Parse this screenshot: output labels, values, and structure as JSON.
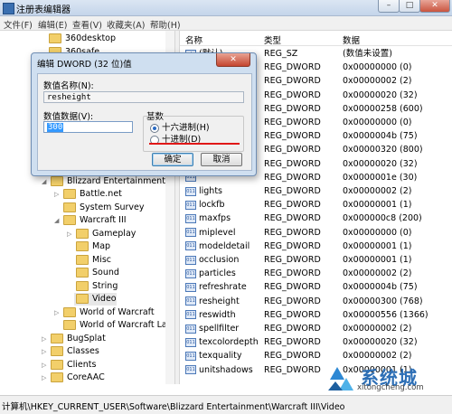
{
  "window": {
    "title": "注册表编辑器",
    "min": "–",
    "max": "□",
    "close": "✕"
  },
  "menu": [
    "文件(F)",
    "编辑(E)",
    "查看(V)",
    "收藏夹(A)",
    "帮助(H)"
  ],
  "tree": {
    "items": [
      {
        "label": "360desktop"
      },
      {
        "label": "360safe"
      },
      {
        "label": "Blizzard Entertainment"
      },
      {
        "label": "Battle.net"
      },
      {
        "label": "System Survey"
      },
      {
        "label": "Warcraft III"
      },
      {
        "label": "Gameplay"
      },
      {
        "label": "Map"
      },
      {
        "label": "Misc"
      },
      {
        "label": "Sound"
      },
      {
        "label": "String"
      },
      {
        "label": "Video"
      },
      {
        "label": "World of Warcraft"
      },
      {
        "label": "World of Warcraft Laur"
      },
      {
        "label": "BugSplat"
      },
      {
        "label": "Classes"
      },
      {
        "label": "Clients"
      },
      {
        "label": "CoreAAC"
      }
    ]
  },
  "list": {
    "headers": {
      "name": "名称",
      "type": "类型",
      "data": "数据"
    },
    "rows": [
      {
        "name": "(默认)",
        "type": "REG_SZ",
        "data": "(数值未设置)"
      },
      {
        "name": "",
        "type": "REG_DWORD",
        "data": "0x00000000 (0)"
      },
      {
        "name": "",
        "type": "REG_DWORD",
        "data": "0x00000002 (2)"
      },
      {
        "name": "",
        "type": "REG_DWORD",
        "data": "0x00000020 (32)"
      },
      {
        "name": "",
        "type": "REG_DWORD",
        "data": "0x00000258 (600)"
      },
      {
        "name": "",
        "type": "REG_DWORD",
        "data": "0x00000000 (0)"
      },
      {
        "name": "",
        "type": "REG_DWORD",
        "data": "0x0000004b (75)"
      },
      {
        "name": "",
        "type": "REG_DWORD",
        "data": "0x00000320 (800)"
      },
      {
        "name": "",
        "type": "REG_DWORD",
        "data": "0x00000020 (32)"
      },
      {
        "name": "",
        "type": "REG_DWORD",
        "data": "0x0000001e (30)"
      },
      {
        "name": "lights",
        "type": "REG_DWORD",
        "data": "0x00000002 (2)"
      },
      {
        "name": "lockfb",
        "type": "REG_DWORD",
        "data": "0x00000001 (1)"
      },
      {
        "name": "maxfps",
        "type": "REG_DWORD",
        "data": "0x000000c8 (200)"
      },
      {
        "name": "miplevel",
        "type": "REG_DWORD",
        "data": "0x00000000 (0)"
      },
      {
        "name": "modeldetail",
        "type": "REG_DWORD",
        "data": "0x00000001 (1)"
      },
      {
        "name": "occlusion",
        "type": "REG_DWORD",
        "data": "0x00000001 (1)"
      },
      {
        "name": "particles",
        "type": "REG_DWORD",
        "data": "0x00000002 (2)"
      },
      {
        "name": "refreshrate",
        "type": "REG_DWORD",
        "data": "0x0000004b (75)"
      },
      {
        "name": "resheight",
        "type": "REG_DWORD",
        "data": "0x00000300 (768)"
      },
      {
        "name": "reswidth",
        "type": "REG_DWORD",
        "data": "0x00000556 (1366)"
      },
      {
        "name": "spellfilter",
        "type": "REG_DWORD",
        "data": "0x00000002 (2)"
      },
      {
        "name": "texcolordepth",
        "type": "REG_DWORD",
        "data": "0x00000020 (32)"
      },
      {
        "name": "texquality",
        "type": "REG_DWORD",
        "data": "0x00000002 (2)"
      },
      {
        "name": "unitshadows",
        "type": "REG_DWORD",
        "data": "0x00000001 (1)"
      }
    ]
  },
  "status": {
    "path": "计算机\\HKEY_CURRENT_USER\\Software\\Blizzard Entertainment\\Warcraft III\\Video"
  },
  "dialog": {
    "title": "编辑 DWORD (32 位)值",
    "close": "✕",
    "name_label": "数值名称(N):",
    "name_value": "resheight",
    "data_label": "数值数据(V):",
    "data_value": "300",
    "base_label": "基数",
    "hex_label": "十六进制(H)",
    "dec_label": "十进制(D)",
    "hex_selected": true,
    "ok": "确定",
    "cancel": "取消"
  },
  "watermark": {
    "text": "系统城",
    "sub": "xitongcheng.com"
  }
}
